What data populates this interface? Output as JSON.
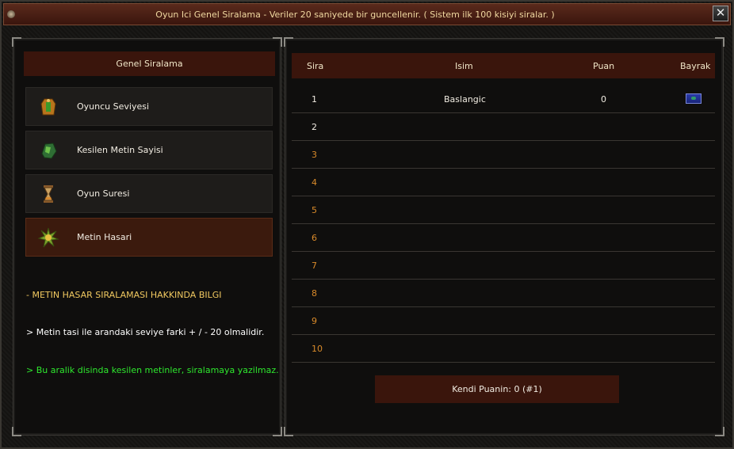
{
  "window": {
    "title": "Oyun Ici Genel Siralama - Veriler 20 saniyede bir guncellenir. ( Sistem ilk 100 kisiyi siralar. )",
    "close_label": "✕"
  },
  "left": {
    "header": "Genel Siralama",
    "items": [
      {
        "label": "Oyuncu Seviyesi",
        "icon": "armor-icon",
        "active": false
      },
      {
        "label": "Kesilen Metin Sayisi",
        "icon": "stone-icon",
        "active": false
      },
      {
        "label": "Oyun Suresi",
        "icon": "hourglass-icon",
        "active": false
      },
      {
        "label": "Metin Hasari",
        "icon": "burst-icon",
        "active": true
      }
    ],
    "info_title": "- METIN HASAR SIRALAMASI HAKKINDA BILGI",
    "info_line1": "> Metin tasi ile arandaki seviye farki + / - 20 olmalidir.",
    "info_line2": "> Bu aralik disinda kesilen metinler, siralamaya yazilmaz."
  },
  "table": {
    "columns": {
      "rank": "Sira",
      "name": "Isim",
      "score": "Puan",
      "flag": "Bayrak"
    },
    "rows": [
      {
        "rank": "1",
        "name": "Baslangic",
        "score": "0",
        "flag": "flag-icon"
      },
      {
        "rank": "2",
        "name": "",
        "score": ""
      },
      {
        "rank": "3",
        "name": "",
        "score": ""
      },
      {
        "rank": "4",
        "name": "",
        "score": ""
      },
      {
        "rank": "5",
        "name": "",
        "score": ""
      },
      {
        "rank": "6",
        "name": "",
        "score": ""
      },
      {
        "rank": "7",
        "name": "",
        "score": ""
      },
      {
        "rank": "8",
        "name": "",
        "score": ""
      },
      {
        "rank": "9",
        "name": "",
        "score": ""
      },
      {
        "rank": "10",
        "name": "",
        "score": ""
      }
    ],
    "own_score": "Kendi Puanin: 0  (#1)"
  },
  "colors": {
    "accent_header": "#3a150c",
    "info_title": "#f0c860",
    "info_green": "#2ee82e",
    "rank_orange": "#d98a2a"
  }
}
